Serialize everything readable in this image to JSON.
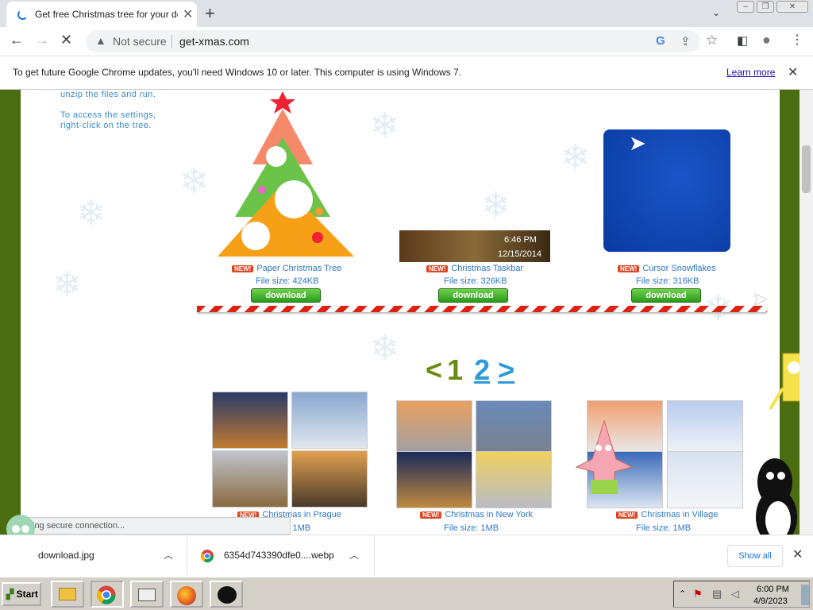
{
  "browser": {
    "tab_title": "Get free Christmas tree for your de",
    "address": {
      "security_label": "Not secure",
      "url": "get-xmas.com"
    },
    "infobar": {
      "message": "To get future Google Chrome updates, you'll need Windows 10 or later. This computer is using Windows 7.",
      "link": "Learn more"
    }
  },
  "page": {
    "instructions": [
      "unzip the files and run.",
      "",
      "To access the settings,",
      "right-click on the tree."
    ],
    "new_badge": "NEW!",
    "cards_top": [
      {
        "title": "Paper Christmas Tree",
        "size": "File size: 424KB",
        "button": "download"
      },
      {
        "title": "Christmas Taskbar",
        "size": "File size: 326KB",
        "button": "download",
        "preview_time": "6:46 PM",
        "preview_date": "12/15/2014"
      },
      {
        "title": "Cursor Snowflakes",
        "size": "File size: 316KB",
        "button": "download"
      }
    ],
    "pagination": {
      "prev": "<",
      "current": "1",
      "next_page": "2",
      "next": ">"
    },
    "cards_bottom": [
      {
        "title": "Christmas in Prague",
        "size": "File size: 1MB"
      },
      {
        "title": "Christmas in New York",
        "size": "File size: 1MB"
      },
      {
        "title": "Christmas in Village",
        "size": "File size: 1MB"
      }
    ],
    "status": "ing secure connection..."
  },
  "downloads": {
    "items": [
      {
        "name": "download.jpg",
        "icon": "image-file-icon"
      },
      {
        "name": "6354d743390dfe0....webp",
        "icon": "chrome-icon"
      }
    ],
    "show_all": "Show all"
  },
  "taskbar": {
    "start": "Start",
    "apps": [
      "file-explorer-icon",
      "chrome-icon",
      "folder-icon",
      "firefox-icon",
      "pingu-icon"
    ],
    "clock_time": "6:00 PM",
    "clock_date": "4/9/2023"
  }
}
